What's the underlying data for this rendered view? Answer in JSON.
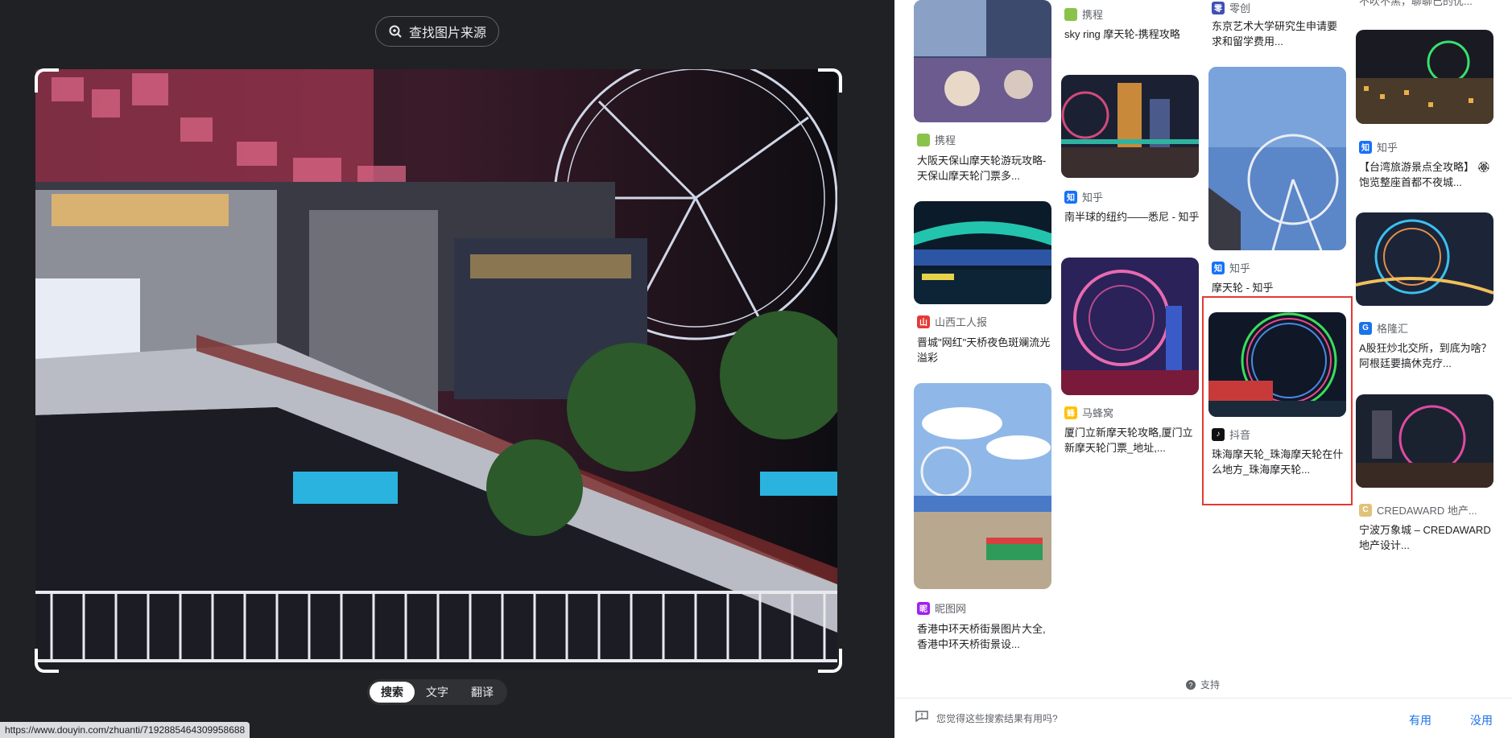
{
  "left_panel": {
    "find_source_label": "查找图片来源",
    "modes": [
      {
        "label": "搜索",
        "active": true
      },
      {
        "label": "文字",
        "active": false
      },
      {
        "label": "翻译",
        "active": false
      }
    ],
    "status_url": "https://www.douyin.com/zhuanti/7192885464309958688"
  },
  "results": {
    "col1": [
      {
        "source": "携程",
        "title": "大阪天保山摩天轮游玩攻略-天保山摩天轮门票多...",
        "favicon_color": "#8bc34a",
        "favicon_text": ""
      },
      {
        "source": "山西工人报",
        "title": "晋城\"网红\"天桥夜色斑斓流光溢彩",
        "favicon_color": "#e53935",
        "favicon_text": "山"
      },
      {
        "source": "昵图网",
        "title": "香港中环天桥街景图片大全,香港中环天桥街景设...",
        "favicon_color": "#a020f0",
        "favicon_text": "昵"
      }
    ],
    "col2": [
      {
        "source": "携程",
        "title": "sky ring 摩天轮-携程攻略",
        "favicon_color": "#8bc34a",
        "favicon_text": ""
      },
      {
        "source": "知乎",
        "title": "南半球的纽约——悉尼 - 知乎",
        "favicon_color": "#1772f6",
        "favicon_text": "知"
      },
      {
        "source": "马蜂窝",
        "title": "厦门立新摩天轮攻略,厦门立新摩天轮门票_地址,...",
        "favicon_color": "#ffc107",
        "favicon_text": "蜂"
      }
    ],
    "col3": [
      {
        "source": "零创",
        "title": "东京艺术大学研究生申请要求和留学费用...",
        "favicon_color": "#3f51b5",
        "favicon_text": "零"
      },
      {
        "source": "知乎",
        "title": "摩天轮 - 知乎",
        "favicon_color": "#1772f6",
        "favicon_text": "知"
      },
      {
        "source": "抖音",
        "title": "珠海摩天轮_珠海摩天轮在什么地方_珠海摩天轮...",
        "favicon_color": "#111111",
        "favicon_text": "♪"
      }
    ],
    "col4": [
      {
        "source": "",
        "title": "不吹不黑，聊聊已的优...",
        "favicon_color": "",
        "favicon_text": ""
      },
      {
        "source": "知乎",
        "title": "【台湾旅游景点全攻略】 🏵 饱览整座首都不夜城...",
        "favicon_color": "#1772f6",
        "favicon_text": "知"
      },
      {
        "source": "格隆汇",
        "title": "A股狂炒北交所，到底为啥？阿根廷要搞休克疗...",
        "favicon_color": "#1a73e8",
        "favicon_text": "G"
      },
      {
        "source": "CREDAWARD 地产...",
        "title": "宁波万象城 – CREDAWARD 地产设计...",
        "favicon_color": "#e0c27a",
        "favicon_text": "C"
      }
    ]
  },
  "support_label": "支持",
  "feedback": {
    "question": "您觉得这些搜索结果有用吗?",
    "yes": "有用",
    "no": "没用"
  }
}
